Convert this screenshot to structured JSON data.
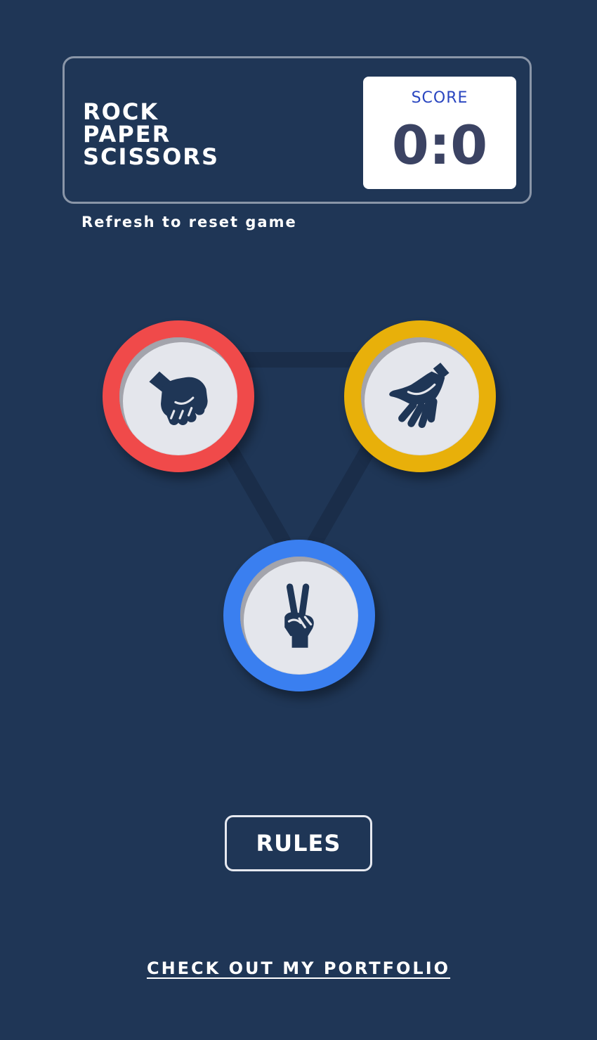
{
  "header": {
    "title_lines": [
      "ROCK",
      "PAPER",
      "SCISSORS"
    ],
    "score_label": "SCORE",
    "score_value": "0:0"
  },
  "reset_hint": "Refresh to reset game",
  "choices": [
    {
      "id": "rock",
      "icon": "fist-icon",
      "color": "#f04a4a"
    },
    {
      "id": "paper",
      "icon": "open-hand-icon",
      "color": "#e8b00a"
    },
    {
      "id": "scissors",
      "icon": "peace-sign-icon",
      "color": "#3a7ff0"
    }
  ],
  "rules_button": "RULES",
  "portfolio_link": "CHECK OUT MY PORTFOLIO",
  "colors": {
    "background": "#1f3656",
    "score_label": "#2a46c0",
    "score_value": "#3b4363",
    "icon": "#1f3656"
  }
}
